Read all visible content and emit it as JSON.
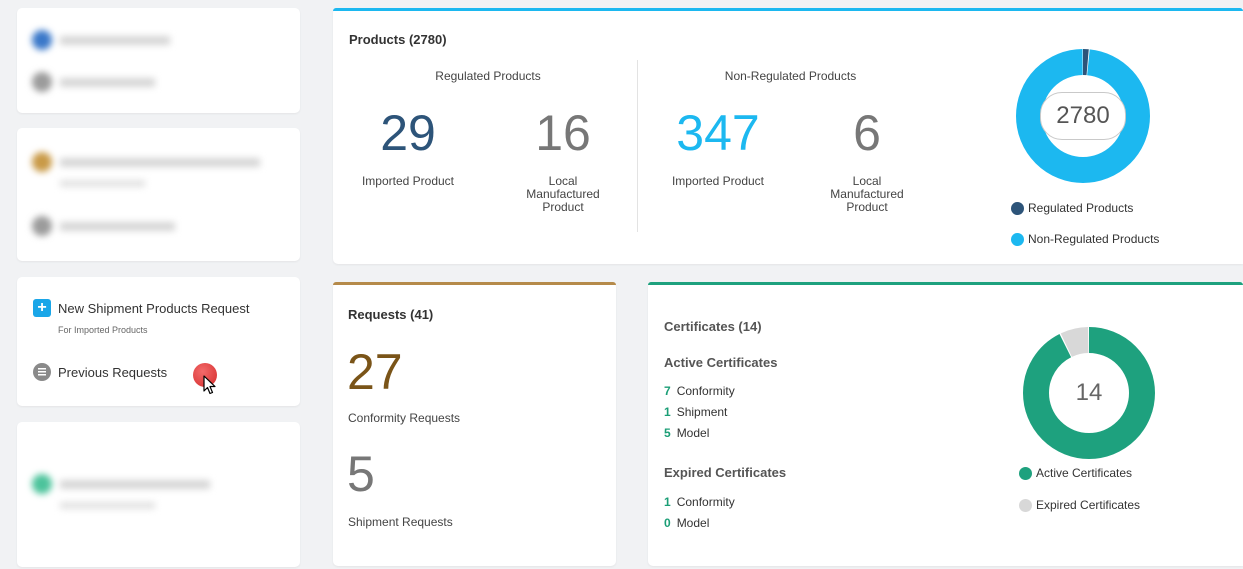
{
  "sidebar": {
    "menu": {
      "new_request_label": "New Shipment Products Request",
      "new_request_sub": "For Imported Products",
      "previous_label": "Previous Requests"
    }
  },
  "products": {
    "title": "Products (2780)",
    "regulated": {
      "title": "Regulated Products",
      "imported_value": "29",
      "imported_label": "Imported Product",
      "local_value": "16",
      "local_label_lines": [
        "Local",
        "Manufactured",
        "Product"
      ]
    },
    "non_regulated": {
      "title": "Non-Regulated Products",
      "imported_value": "347",
      "imported_label": "Imported Product",
      "local_value": "6",
      "local_label_lines": [
        "Local",
        "Manufactured",
        "Product"
      ]
    },
    "donut": {
      "center": "2780",
      "slices": [
        {
          "label": "Regulated Products",
          "value": 45,
          "color": "#2d5479"
        },
        {
          "label": "Non-Regulated Products",
          "value": 2735,
          "color": "#1cb8f0"
        }
      ]
    }
  },
  "requests": {
    "title": "Requests (41)",
    "conformity_value": "27",
    "conformity_label": "Conformity Requests",
    "shipment_value": "5",
    "shipment_label": "Shipment Requests"
  },
  "certificates": {
    "title": "Certificates (14)",
    "active": {
      "title": "Active Certificates",
      "items": [
        {
          "num": "7",
          "label": "Conformity"
        },
        {
          "num": "1",
          "label": "Shipment"
        },
        {
          "num": "5",
          "label": "Model"
        }
      ]
    },
    "expired": {
      "title": "Expired Certificates",
      "items": [
        {
          "num": "1",
          "label": "Conformity"
        },
        {
          "num": "0",
          "label": "Model"
        }
      ]
    },
    "donut": {
      "center": "14",
      "slices": [
        {
          "label": "Active Certificates",
          "value": 13,
          "color": "#1ea17e"
        },
        {
          "label": "Expired Certificates",
          "value": 1,
          "color": "#d8d8d8"
        }
      ]
    }
  },
  "colors": {
    "regulated_num": "#2d5479",
    "non_regulated_num": "#1cb8f0",
    "local_num": "#777777",
    "requests_accent": "#b58a4a",
    "requests_num": "#7a5418",
    "certificates_accent": "#1ea17e",
    "products_accent": "#1cb8f0"
  },
  "icons": {
    "new_request": "plus-icon",
    "previous_requests": "list-icon"
  }
}
